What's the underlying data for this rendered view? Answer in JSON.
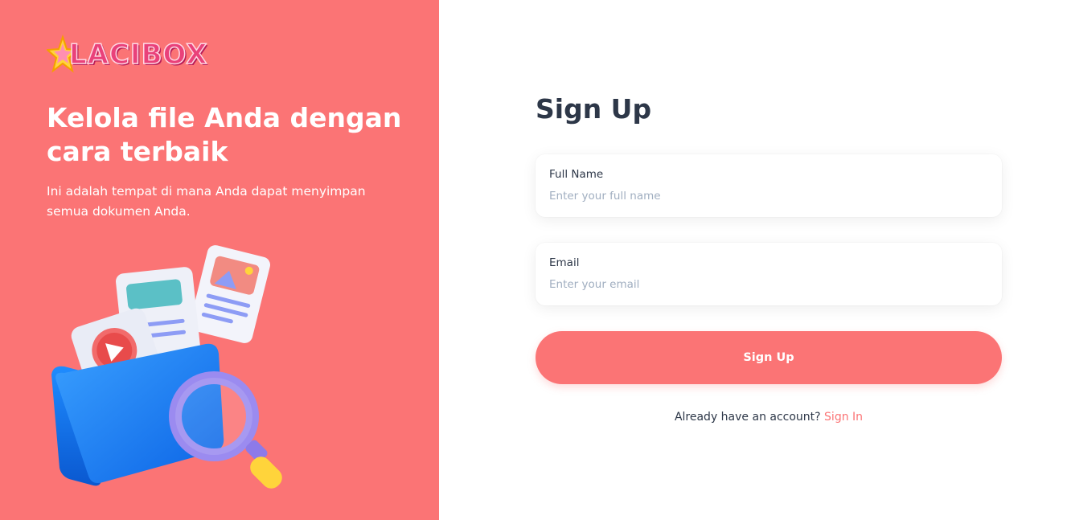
{
  "brand": {
    "name": "LACIBOX"
  },
  "hero": {
    "title": "Kelola file Anda dengan cara terbaik",
    "subtitle": "Ini adalah tempat di mana Anda dapat menyimpan semua dokumen Anda."
  },
  "form": {
    "title": "Sign Up",
    "full_name": {
      "label": "Full Name",
      "placeholder": "Enter your full name",
      "value": ""
    },
    "email": {
      "label": "Email",
      "placeholder": "Enter your email",
      "value": ""
    },
    "submit_label": "Sign Up",
    "signin_prompt": "Already have an account?",
    "signin_link": "Sign In"
  },
  "colors": {
    "accent": "#fb7475",
    "text_dark": "#2d3748",
    "placeholder": "#a0aec0",
    "logo_pink": "#e9417a"
  },
  "icons": {
    "logo": "star-icon",
    "illustration": "folder-documents-magnifier-illustration"
  }
}
